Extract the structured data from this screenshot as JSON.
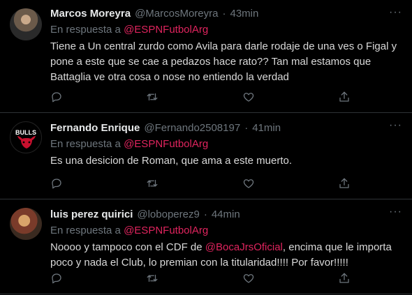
{
  "tweets": [
    {
      "name": "Marcos Moreyra",
      "handle": "@MarcosMoreyra",
      "dot": "·",
      "time": "43min",
      "reply_prefix": "En respuesta a",
      "reply_to": "@ESPNFutbolArg",
      "text": "Tiene a Un central zurdo como Avila para darle rodaje de una ves o Figal y pone a este que se cae a pedazos hace rato?? Tan mal estamos que Battaglia ve otra cosa o nose no entiendo la verdad"
    },
    {
      "name": "Fernando Enrique",
      "handle": "@Fernando2508197",
      "dot": "·",
      "time": "41min",
      "reply_prefix": "En respuesta a",
      "reply_to": "@ESPNFutbolArg",
      "avatar_text": "BULLS",
      "text": "Es una desicion de Roman, que ama a este muerto."
    },
    {
      "name": "luis perez quirici",
      "handle": "@loboperez9",
      "dot": "·",
      "time": "44min",
      "reply_prefix": "En respuesta a",
      "reply_to": "@ESPNFutbolArg",
      "text_before": "Noooo y tampoco con el CDF de",
      "text_mention": "@BocaJrsOficial",
      "text_after": ", encima que le importa poco y nada el Club, lo premian con la titularidad!!!! Por favor!!!!!"
    }
  ],
  "more_label": "···",
  "colors": {
    "accent": "#e0245e",
    "muted": "#6e767d",
    "text": "#d9d9d9",
    "background": "#000000"
  },
  "action_icons": [
    "reply-icon",
    "retweet-icon",
    "like-icon",
    "share-icon"
  ]
}
